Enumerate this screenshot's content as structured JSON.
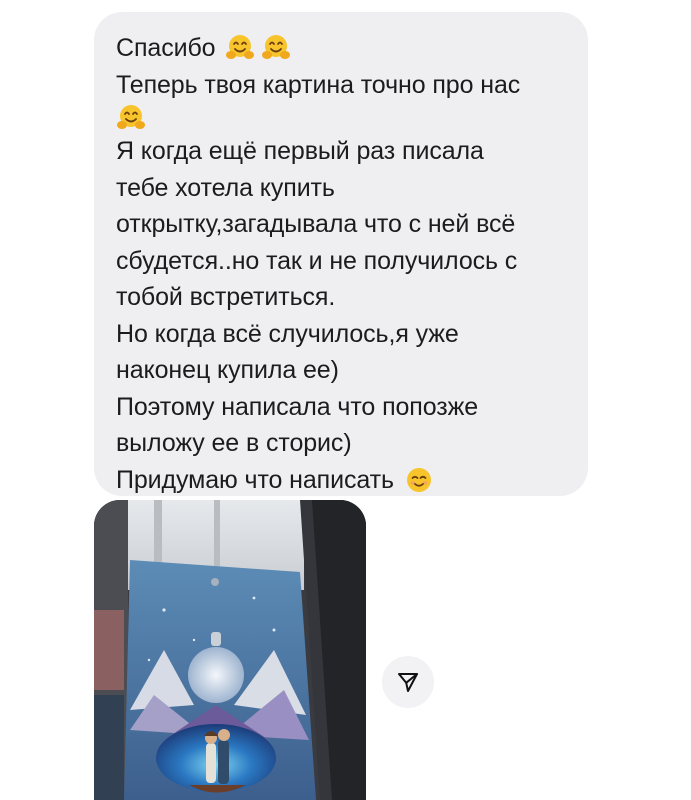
{
  "message": {
    "line1": "Спасибо",
    "line2": "Теперь твоя картина точно про нас",
    "line4": "Я когда ещё первый раз писала",
    "line5": "тебе хотела купить",
    "line6": "открытку,загадывала что с ней всё",
    "line7": "сбудется..но так и не получилось с",
    "line8": "тобой встретиться.",
    "line9": "Но когда всё случилось,я уже",
    "line10": "наконец купила ее)",
    "line11": "Поэтому написала что попозже",
    "line12": "выложу ее в сторис)",
    "line13": "Придумаю что написать"
  },
  "emojis": {
    "hug": "hugging-face-emoji",
    "smile": "smiling-face-emoji"
  },
  "photo": {
    "icon": "painting-photo-attachment"
  },
  "share_button": {
    "icon": "paper-plane-icon"
  },
  "colors": {
    "bubble_bg": "#efeff2",
    "text": "#1c1c1e",
    "share_bg": "#f2f2f4"
  }
}
